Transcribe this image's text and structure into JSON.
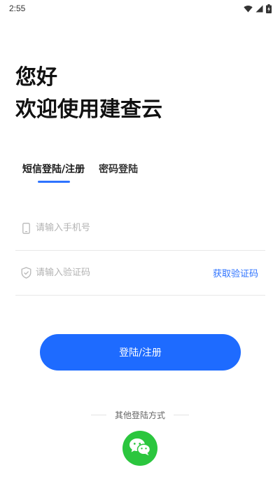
{
  "status_bar": {
    "time": "2:55",
    "icons": [
      "wifi-icon",
      "signal-icon",
      "battery-charging-icon"
    ]
  },
  "greeting": {
    "line1": "您好",
    "line2": "欢迎使用建查云"
  },
  "tabs": [
    {
      "label": "短信登陆/注册",
      "active": true
    },
    {
      "label": "密码登陆",
      "active": false
    }
  ],
  "form": {
    "phone_placeholder": "请输入手机号",
    "phone_value": "",
    "code_placeholder": "请输入验证码",
    "code_value": "",
    "get_code_label": "获取验证码"
  },
  "login_button_label": "登陆/注册",
  "other_login": {
    "label": "其他登陆方式",
    "methods": [
      "wechat-icon"
    ]
  },
  "colors": {
    "accent": "#2e73ff",
    "button": "#1e6bff",
    "wechat": "#2bc63e"
  }
}
